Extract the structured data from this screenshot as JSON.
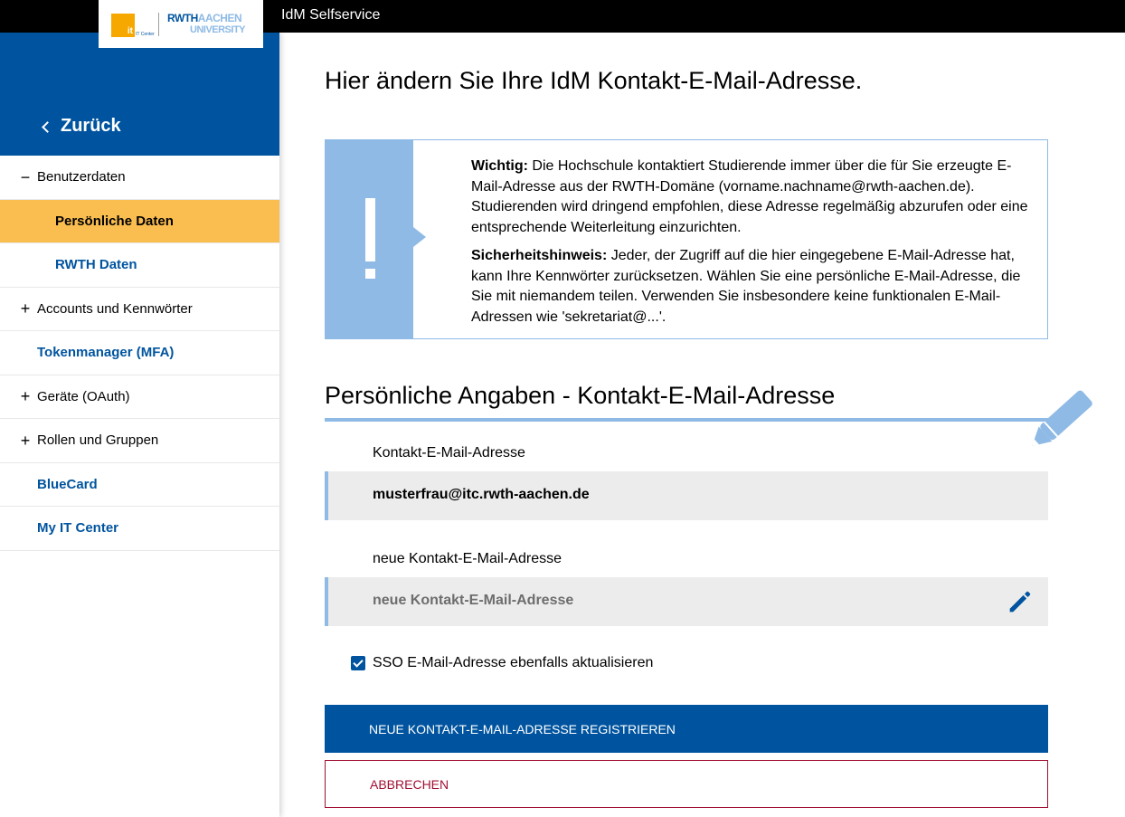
{
  "app": {
    "title": "IdM Selfservice"
  },
  "logo": {
    "it": "it",
    "it_center": "IT Center",
    "rwth": "RWTH",
    "aachen": "AACHEN",
    "university": "UNIVERSITY"
  },
  "sidebar": {
    "back_label": "Zurück",
    "items": [
      {
        "label": "Benutzerdaten",
        "sign": "−"
      },
      {
        "label": "Persönliche Daten"
      },
      {
        "label": "RWTH Daten"
      },
      {
        "label": "Accounts und Kennwörter",
        "sign": "+"
      },
      {
        "label": "Tokenmanager (MFA)"
      },
      {
        "label": "Geräte (OAuth)",
        "sign": "+"
      },
      {
        "label": "Rollen und Gruppen",
        "sign": "+"
      },
      {
        "label": "BlueCard"
      },
      {
        "label": "My IT Center"
      }
    ]
  },
  "main": {
    "title": "Hier ändern Sie Ihre IdM Kontakt-E-Mail-Adresse.",
    "notice": {
      "p1_bold": "Wichtig:",
      "p1": " Die Hochschule kontaktiert Studierende immer über die für Sie erzeugte E-Mail-Adresse aus der RWTH-Domäne (vorname.nachname@rwth-aachen.de). Studierenden wird dringend empfohlen, diese Adresse regelmäßig abzurufen oder eine entsprechende Weiterleitung einzurichten.",
      "p2_bold": "Sicherheitshinweis:",
      "p2": " Jeder, der Zugriff auf die hier eingegebene E-Mail-Adresse hat, kann Ihre Kennwörter zurücksetzen. Wählen Sie eine persönliche E-Mail-Adresse, die Sie mit niemandem teilen. Verwenden Sie insbesondere keine funktionalen E-Mail-Adressen wie 'sekretariat@...'."
    },
    "section_title": "Persönliche Angaben - Kontakt-E-Mail-Adresse",
    "current_email": {
      "label": "Kontakt-E-Mail-Adresse",
      "value": "musterfrau@itc.rwth-aachen.de"
    },
    "new_email": {
      "label": "neue Kontakt-E-Mail-Adresse",
      "value": "",
      "placeholder": "neue Kontakt-E-Mail-Adresse"
    },
    "sso_checkbox": {
      "label": "SSO E-Mail-Adresse ebenfalls aktualisieren",
      "checked": true
    },
    "submit_label": "NEUE KONTAKT-E-MAIL-ADRESSE REGISTRIEREN",
    "cancel_label": "ABBRECHEN"
  },
  "colors": {
    "rwth_blue": "#00549f",
    "light_blue": "#8ebae5",
    "active_yellow": "#fabe50",
    "cancel_red": "#a11035",
    "it_orange": "#f6a800"
  },
  "icons": [
    "chevron-left-icon",
    "minus-icon",
    "plus-icon",
    "exclamation-icon",
    "pencil-icon"
  ]
}
